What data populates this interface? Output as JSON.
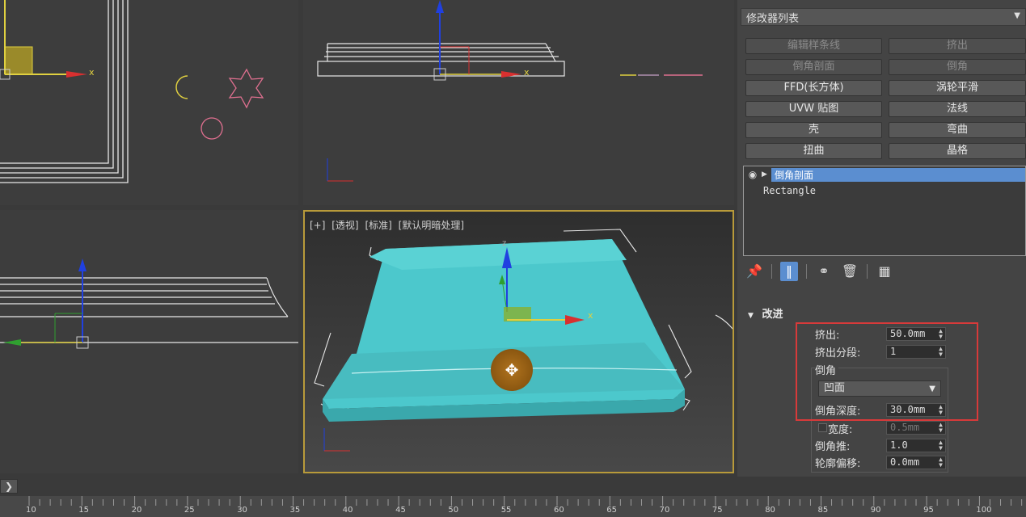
{
  "viewports": {
    "perspective": {
      "labels": [
        "[+]",
        "[透视]",
        "[标准]",
        "[默认明暗处理]"
      ]
    },
    "axis_labels": {
      "x": "x",
      "y": "y",
      "z": "z"
    }
  },
  "panel": {
    "modifier_list": "修改器列表",
    "buttons": [
      {
        "label": "编辑样条线",
        "enabled": false
      },
      {
        "label": "挤出",
        "enabled": false
      },
      {
        "label": "倒角剖面",
        "enabled": false
      },
      {
        "label": "倒角",
        "enabled": false
      },
      {
        "label": "FFD(长方体)",
        "enabled": true
      },
      {
        "label": "涡轮平滑",
        "enabled": true
      },
      {
        "label": "UVW 贴图",
        "enabled": true
      },
      {
        "label": "法线",
        "enabled": true
      },
      {
        "label": "壳",
        "enabled": true
      },
      {
        "label": "弯曲",
        "enabled": true
      },
      {
        "label": "扭曲",
        "enabled": true
      },
      {
        "label": "晶格",
        "enabled": true
      }
    ],
    "stack": {
      "selected": "倒角剖面",
      "base": "Rectangle"
    },
    "rollout": {
      "title": "改进",
      "extrude_label": "挤出:",
      "extrude_value": "50.0mm",
      "segments_label": "挤出分段:",
      "segments_value": "1",
      "bevel_group": "倒角",
      "bevel_type": "凹面",
      "depth_label": "倒角深度:",
      "depth_value": "30.0mm",
      "width_label": "宽度:",
      "width_value": "0.5mm",
      "push_label": "倒角推:",
      "push_value": "1.0",
      "offset_label": "轮廓偏移:",
      "offset_value": "0.0mm"
    }
  },
  "timeline": {
    "ticks": [
      "10",
      "15",
      "20",
      "25",
      "30",
      "35",
      "40",
      "45",
      "50",
      "55",
      "60",
      "65",
      "70",
      "75",
      "80",
      "85",
      "90",
      "95",
      "100"
    ]
  },
  "colors": {
    "accent_blue": "#5b8ed0",
    "highlight_red": "#d83a3a",
    "model_cyan": "#4cc8cc",
    "active_viewport_border": "#b89a3a"
  }
}
